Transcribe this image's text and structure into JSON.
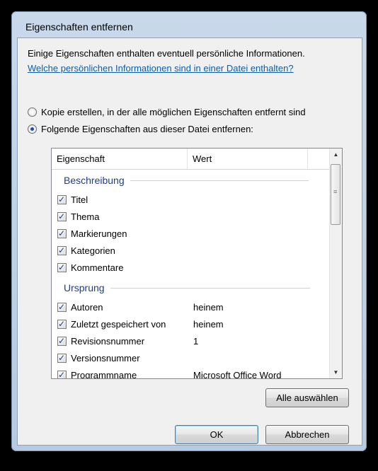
{
  "window": {
    "title": "Eigenschaften entfernen"
  },
  "dialog": {
    "info_text": "Einige Eigenschaften enthalten eventuell persönliche Informationen.",
    "link_text": "Welche persönlichen Informationen sind in einer Datei enthalten?",
    "radio_copy": {
      "label": "Kopie erstellen, in der alle möglichen Eigenschaften entfernt sind",
      "checked": false
    },
    "radio_remove": {
      "label": "Folgende Eigenschaften aus dieser Datei entfernen:",
      "checked": true
    }
  },
  "list": {
    "columns": [
      "Eigenschaft",
      "Wert"
    ],
    "groups": [
      {
        "name": "Beschreibung",
        "items": [
          {
            "label": "Titel",
            "value": "",
            "checked": true
          },
          {
            "label": "Thema",
            "value": "",
            "checked": true
          },
          {
            "label": "Markierungen",
            "value": "",
            "checked": true
          },
          {
            "label": "Kategorien",
            "value": "",
            "checked": true
          },
          {
            "label": "Kommentare",
            "value": "",
            "checked": true
          }
        ]
      },
      {
        "name": "Ursprung",
        "items": [
          {
            "label": "Autoren",
            "value": "heinem",
            "checked": true
          },
          {
            "label": "Zuletzt gespeichert von",
            "value": "heinem",
            "checked": true
          },
          {
            "label": "Revisionsnummer",
            "value": "1",
            "checked": true
          },
          {
            "label": "Versionsnummer",
            "value": "",
            "checked": true
          },
          {
            "label": "Programmname",
            "value": "Microsoft Office Word",
            "checked": true
          }
        ]
      }
    ]
  },
  "buttons": {
    "select_all": "Alle auswählen",
    "ok": "OK",
    "cancel": "Abbrechen"
  },
  "icons": {
    "check": "checkmark-icon",
    "scroll_up": "scroll-up-arrow-icon",
    "scroll_down": "scroll-down-arrow-icon"
  }
}
